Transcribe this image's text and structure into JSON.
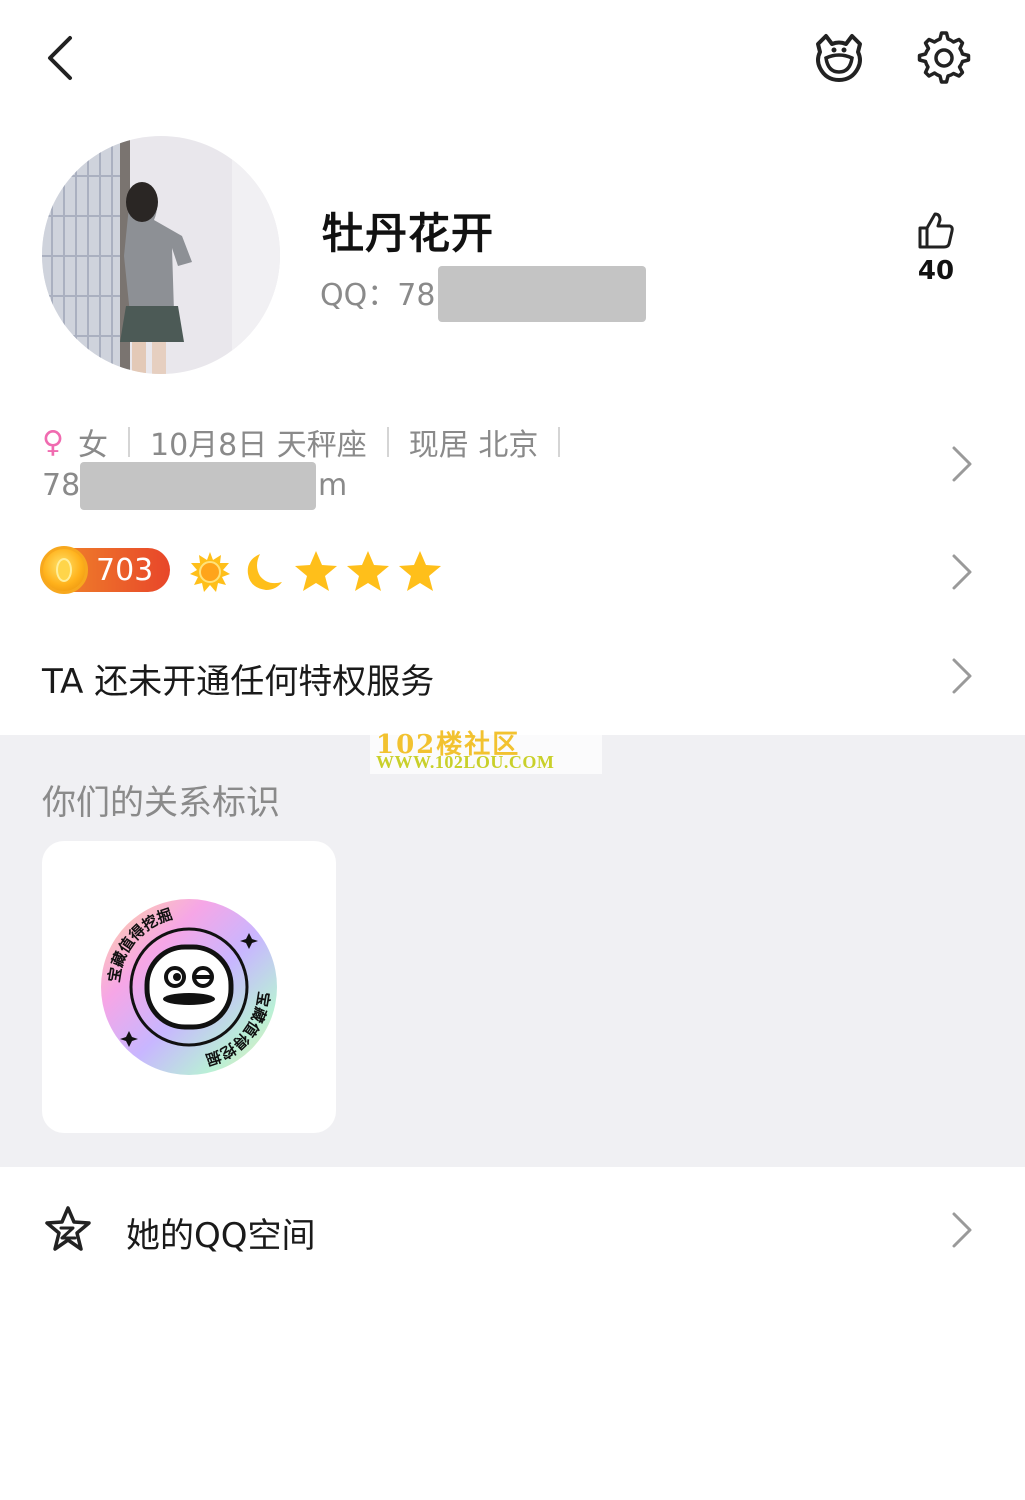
{
  "header": {
    "back_icon": "chevron-left-icon",
    "pet_icon": "pet-face-icon",
    "settings_icon": "gear-icon"
  },
  "profile": {
    "nickname": "牡丹花开",
    "qq_label": "QQ：",
    "qq_prefix": "78",
    "likes": "40"
  },
  "info": {
    "gender": "女",
    "birthday": "10月8日 天秤座",
    "location": "现居 北京",
    "id_prefix": "78",
    "id_suffix": "m"
  },
  "level": {
    "value": "703",
    "icons": [
      "sun-icon",
      "moon-icon",
      "star-icon",
      "star-icon",
      "star-icon"
    ]
  },
  "privilege": {
    "text": "TA 还未开通任何特权服务"
  },
  "relationship": {
    "title": "你们的关系标识",
    "badge_text": "宝藏值得挖掘"
  },
  "qzone": {
    "label": "她的QQ空间"
  },
  "watermark": {
    "line1": "102楼社区",
    "line2": "WWW.102LOU.COM"
  },
  "colors": {
    "level_badge": "#e8462a",
    "star": "#ffbf1a",
    "female": "#f06bb0",
    "section_bg": "#f0f0f3"
  }
}
